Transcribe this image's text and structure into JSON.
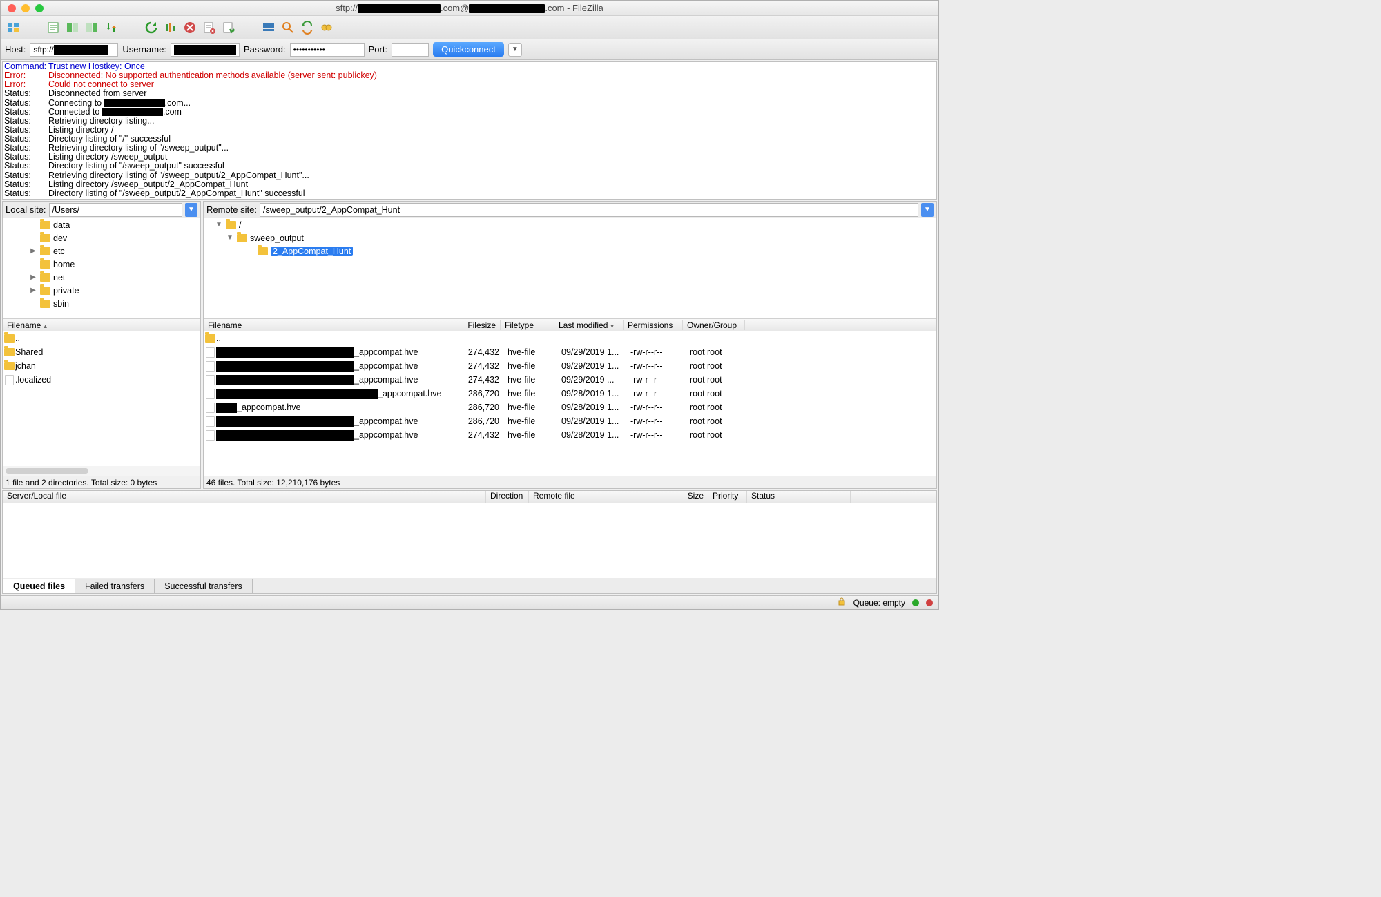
{
  "title": {
    "prefix": "sftp://",
    "suffix1": ".com@",
    "suffix2": ".com - FileZilla"
  },
  "quickconnect": {
    "host_label": "Host:",
    "host_value": "sftp://",
    "user_label": "Username:",
    "pass_label": "Password:",
    "pass_value": "•••••••••••",
    "port_label": "Port:",
    "button": "Quickconnect"
  },
  "log": [
    {
      "cls": "cmd",
      "label": "Command:",
      "text": "Trust new Hostkey: Once"
    },
    {
      "cls": "err",
      "label": "Error:",
      "text": "Disconnected: No supported authentication methods available (server sent: publickey)"
    },
    {
      "cls": "err",
      "label": "Error:",
      "text": "Could not connect to server"
    },
    {
      "cls": "stat",
      "label": "Status:",
      "text": "Disconnected from server"
    },
    {
      "cls": "stat",
      "label": "Status:",
      "text": "Connecting to ",
      "blk": 88,
      "after": ".com..."
    },
    {
      "cls": "stat",
      "label": "Status:",
      "text": "Connected to ",
      "blk": 88,
      "after": ".com"
    },
    {
      "cls": "stat",
      "label": "Status:",
      "text": "Retrieving directory listing..."
    },
    {
      "cls": "stat",
      "label": "Status:",
      "text": "Listing directory /"
    },
    {
      "cls": "stat",
      "label": "Status:",
      "text": "Directory listing of \"/\" successful"
    },
    {
      "cls": "stat",
      "label": "Status:",
      "text": "Retrieving directory listing of \"/sweep_output\"..."
    },
    {
      "cls": "stat",
      "label": "Status:",
      "text": "Listing directory /sweep_output"
    },
    {
      "cls": "stat",
      "label": "Status:",
      "text": "Directory listing of \"/sweep_output\" successful"
    },
    {
      "cls": "stat",
      "label": "Status:",
      "text": "Retrieving directory listing of \"/sweep_output/2_AppCompat_Hunt\"..."
    },
    {
      "cls": "stat",
      "label": "Status:",
      "text": "Listing directory /sweep_output/2_AppCompat_Hunt"
    },
    {
      "cls": "stat",
      "label": "Status:",
      "text": "Directory listing of \"/sweep_output/2_AppCompat_Hunt\" successful"
    }
  ],
  "local": {
    "label": "Local site:",
    "path": "/Users/",
    "tree": [
      {
        "indent": 30,
        "arrow": "",
        "name": "data"
      },
      {
        "indent": 30,
        "arrow": "",
        "name": "dev"
      },
      {
        "indent": 30,
        "arrow": "▶",
        "name": "etc"
      },
      {
        "indent": 30,
        "arrow": "",
        "name": "home"
      },
      {
        "indent": 30,
        "arrow": "▶",
        "name": "net"
      },
      {
        "indent": 30,
        "arrow": "▶",
        "name": "private"
      },
      {
        "indent": 30,
        "arrow": "",
        "name": "sbin"
      }
    ],
    "hdr": {
      "filename": "Filename"
    },
    "files": [
      {
        "type": "up",
        "name": ".."
      },
      {
        "type": "folder",
        "name": "Shared"
      },
      {
        "type": "folder",
        "name": "jchan"
      },
      {
        "type": "file",
        "name": ".localized"
      }
    ],
    "summary": "1 file and 2 directories. Total size: 0 bytes"
  },
  "remote": {
    "label": "Remote site:",
    "path": "/sweep_output/2_AppCompat_Hunt",
    "tree": [
      {
        "indent": 8,
        "arrow": "▼",
        "name": "/"
      },
      {
        "indent": 24,
        "arrow": "▼",
        "name": "sweep_output"
      },
      {
        "indent": 54,
        "arrow": "",
        "name": "2_AppCompat_Hunt",
        "selected": true
      }
    ],
    "hdr": {
      "filename": "Filename",
      "filesize": "Filesize",
      "filetype": "Filetype",
      "modified": "Last modified",
      "perms": "Permissions",
      "owner": "Owner/Group"
    },
    "files": [
      {
        "type": "up",
        "name": ".."
      },
      {
        "type": "file",
        "blk": 200,
        "suffix": "_appcompat.hve",
        "size": "274,432",
        "ftype": "hve-file",
        "mod": "09/29/2019 1...",
        "perm": "-rw-r--r--",
        "own": "root root"
      },
      {
        "type": "file",
        "blk": 200,
        "suffix": "_appcompat.hve",
        "size": "274,432",
        "ftype": "hve-file",
        "mod": "09/29/2019 1...",
        "perm": "-rw-r--r--",
        "own": "root root"
      },
      {
        "type": "file",
        "blk": 200,
        "suffix": "_appcompat.hve",
        "size": "274,432",
        "ftype": "hve-file",
        "mod": "09/29/2019 ...",
        "perm": "-rw-r--r--",
        "own": "root root"
      },
      {
        "type": "file",
        "blk": 234,
        "suffix": "_appcompat.hve",
        "size": "286,720",
        "ftype": "hve-file",
        "mod": "09/28/2019 1...",
        "perm": "-rw-r--r--",
        "own": "root root"
      },
      {
        "type": "file",
        "blk": 30,
        "suffix": "_appcompat.hve",
        "size": "286,720",
        "ftype": "hve-file",
        "mod": "09/28/2019 1...",
        "perm": "-rw-r--r--",
        "own": "root root"
      },
      {
        "type": "file",
        "blk": 200,
        "suffix": "_appcompat.hve",
        "size": "286,720",
        "ftype": "hve-file",
        "mod": "09/28/2019 1...",
        "perm": "-rw-r--r--",
        "own": "root root"
      },
      {
        "type": "file",
        "blk": 200,
        "suffix": "_appcompat.hve",
        "size": "274,432",
        "ftype": "hve-file",
        "mod": "09/28/2019 1...",
        "perm": "-rw-r--r--",
        "own": "root root"
      }
    ],
    "summary": "46 files. Total size: 12,210,176 bytes"
  },
  "queue": {
    "hdr": {
      "local": "Server/Local file",
      "dir": "Direction",
      "remote": "Remote file",
      "size": "Size",
      "priority": "Priority",
      "status": "Status"
    },
    "tabs": {
      "queued": "Queued files",
      "failed": "Failed transfers",
      "success": "Successful transfers"
    }
  },
  "statusbar": {
    "queue": "Queue: empty"
  }
}
